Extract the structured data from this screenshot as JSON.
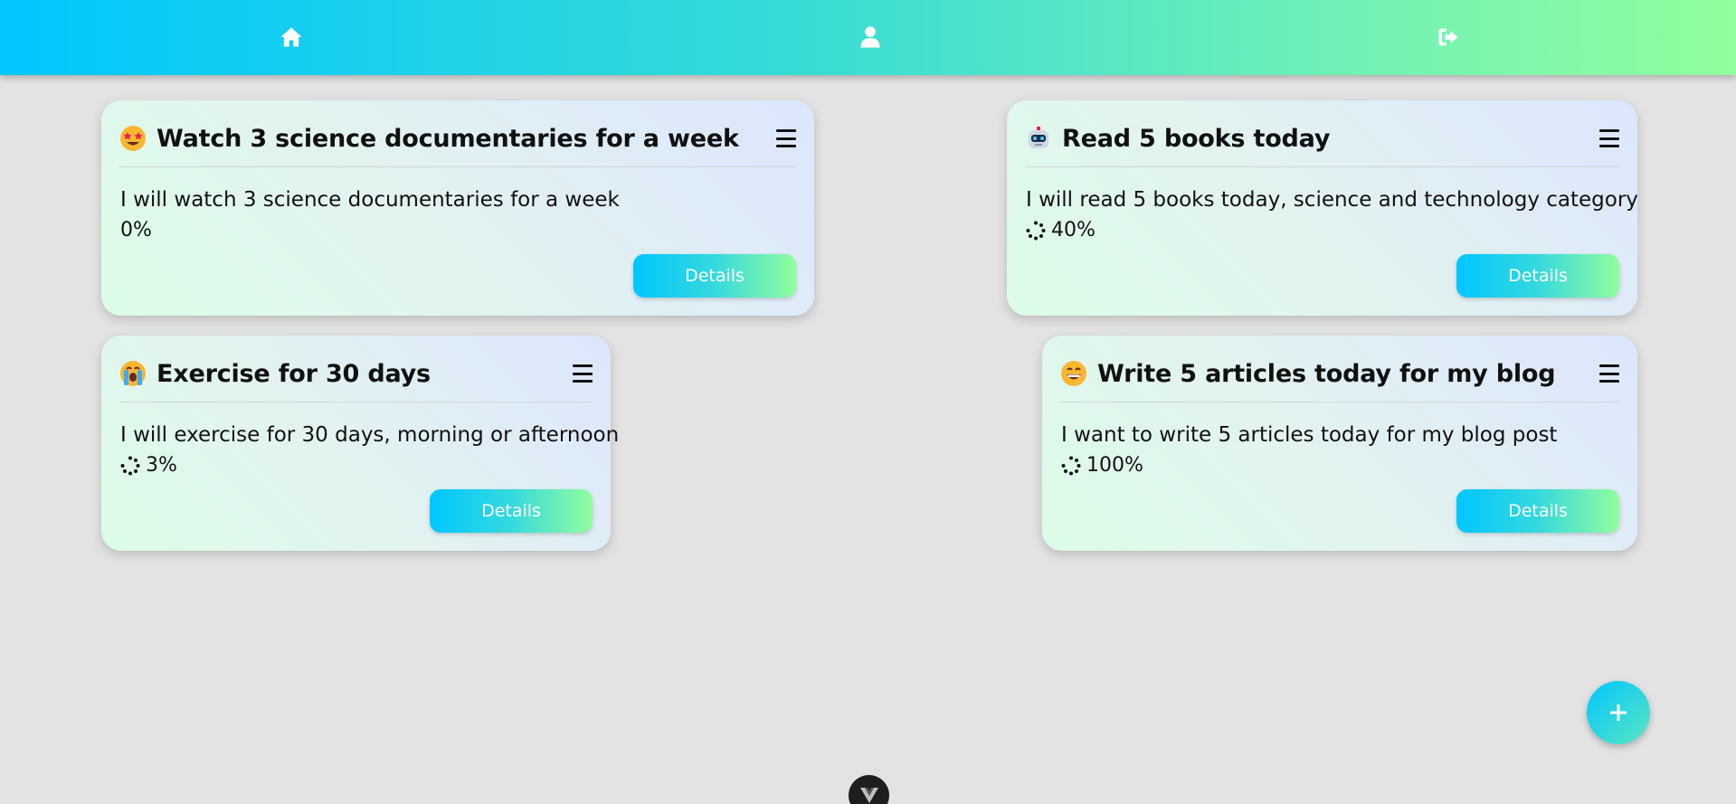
{
  "nav": {
    "icons": [
      "home-icon",
      "user-icon",
      "logout-icon"
    ]
  },
  "cards": [
    {
      "emoji": "star-struck-emoji",
      "title": "Watch 3 science documentaries for a week",
      "description": "I will watch 3 science documentaries for a week",
      "progress": "0%",
      "progress_value": 0,
      "show_spinner": false,
      "details_label": "Details"
    },
    {
      "emoji": "robot-emoji",
      "title": "Read 5 books today",
      "description": "I will read 5 books today, science and technology category",
      "progress": "40%",
      "progress_value": 40,
      "show_spinner": true,
      "details_label": "Details"
    },
    {
      "emoji": "crying-face-emoji",
      "title": "Exercise for 30 days",
      "description": "I will exercise for 30 days, morning or afternoon",
      "progress": "3%",
      "progress_value": 3,
      "show_spinner": true,
      "details_label": "Details"
    },
    {
      "emoji": "grinning-face-emoji",
      "title": "Write 5 articles today for my blog",
      "description": "I want to write 5 articles today for my blog post",
      "progress": "100%",
      "progress_value": 100,
      "show_spinner": true,
      "details_label": "Details"
    }
  ],
  "fab": {
    "icon": "plus-icon"
  },
  "devtools": {
    "icon": "vue-devtools-icon"
  },
  "colors": {
    "gradient_start": "#00c6ff",
    "gradient_end": "#92fe9d",
    "background": "#e3e3e3"
  }
}
